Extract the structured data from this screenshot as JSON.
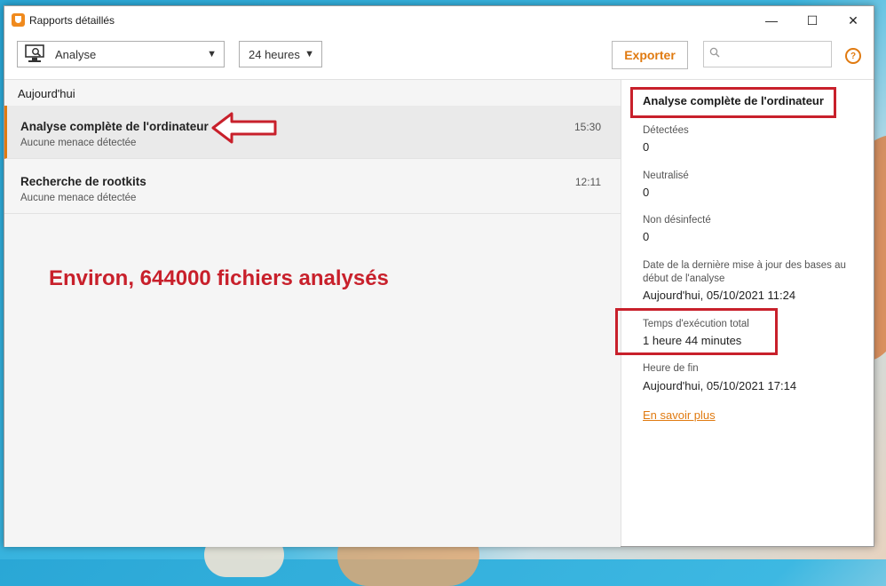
{
  "window": {
    "title": "Rapports détaillés",
    "minimize": "—",
    "maximize": "☐",
    "close": "✕"
  },
  "toolbar": {
    "report_type": "Analyse",
    "period": "24 heures",
    "export_label": "Exporter",
    "search_placeholder": "",
    "help": "?"
  },
  "list": {
    "group": "Aujourd'hui",
    "items": [
      {
        "title": "Analyse complète de l'ordinateur",
        "subtitle": "Aucune menace détectée",
        "time": "15:30"
      },
      {
        "title": "Recherche de rootkits",
        "subtitle": "Aucune menace détectée",
        "time": "12:11"
      }
    ]
  },
  "annotation": {
    "text": "Environ, 644000 fichiers analysés"
  },
  "details": {
    "title": "Analyse complète de l'ordinateur",
    "fields": [
      {
        "label": "Détectées",
        "value": "0"
      },
      {
        "label": "Neutralisé",
        "value": "0"
      },
      {
        "label": "Non désinfecté",
        "value": "0"
      },
      {
        "label": "Date de la dernière mise à jour des bases au début de l'analyse",
        "value": "Aujourd'hui, 05/10/2021 11:24"
      },
      {
        "label": "Temps d'exécution total",
        "value": "1 heure 44 minutes"
      },
      {
        "label": "Heure de fin",
        "value": "Aujourd'hui, 05/10/2021 17:14"
      }
    ],
    "more_link": "En savoir plus"
  },
  "colors": {
    "accent": "#e07a10",
    "annotation": "#c8202b",
    "selection_bar": "#e07a10"
  }
}
